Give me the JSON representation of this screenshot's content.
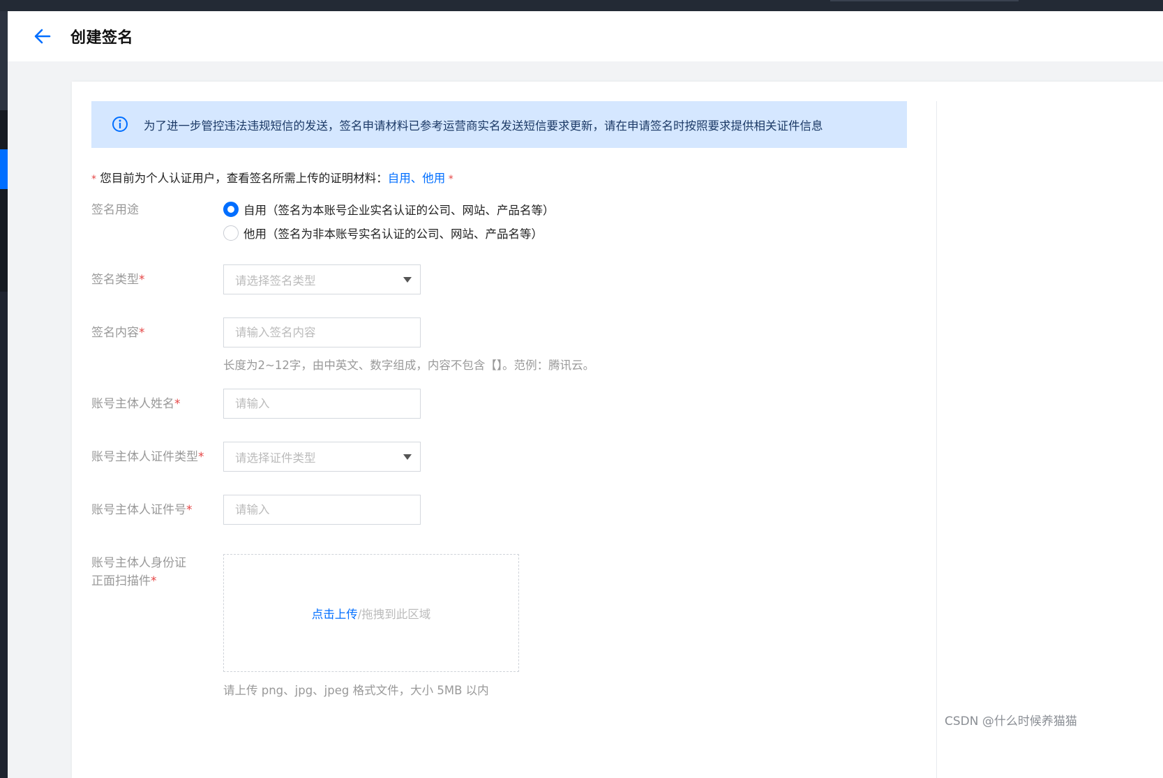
{
  "header": {
    "title": "创建签名",
    "back_icon": "arrow-left-icon"
  },
  "notice": {
    "icon": "info-circle-icon",
    "text": "为了进一步管控违法违规短信的发送，签名申请材料已参考运营商实名发送短信要求更新，请在申请签名时按照要求提供相关证件信息"
  },
  "requirement": {
    "star": "*",
    "prefix": "您目前为个人认证用户，查看签名所需上传的证明材料：",
    "link_self": "自用",
    "separator": "、",
    "link_other": "他用",
    "suffix_star": " *"
  },
  "form": {
    "purpose": {
      "label": "签名用途",
      "options": [
        {
          "label": "自用（签名为本账号企业实名认证的公司、网站、产品名等）",
          "checked": true
        },
        {
          "label": "他用（签名为非本账号实名认证的公司、网站、产品名等）",
          "checked": false
        }
      ]
    },
    "sign_type": {
      "label": "签名类型",
      "required_mark": "*",
      "placeholder": "请选择签名类型"
    },
    "sign_content": {
      "label": "签名内容",
      "required_mark": "*",
      "placeholder": "请输入签名内容",
      "hint": "长度为2~12字，由中英文、数字组成，内容不包含【】。范例：腾讯云。"
    },
    "owner_name": {
      "label": "账号主体人姓名",
      "required_mark": "*",
      "placeholder": "请输入"
    },
    "owner_id_type": {
      "label": "账号主体人证件类型",
      "required_mark": "*",
      "placeholder": "请选择证件类型"
    },
    "owner_id_number": {
      "label": "账号主体人证件号",
      "required_mark": "*",
      "placeholder": "请输入"
    },
    "id_scan": {
      "label_line1": "账号主体人身份证",
      "label_line2": "正面扫描件",
      "required_mark": "*",
      "upload_link": "点击上传",
      "upload_rest": "/拖拽到此区域",
      "hint": "请上传 png、jpg、jpeg 格式文件，大小 5MB 以内"
    }
  },
  "watermark": "CSDN @什么时候养猫猫",
  "colors": {
    "primary": "#006eff",
    "notice_bg": "#d5e7ff",
    "required": "#e54545",
    "topbar": "#232a35"
  }
}
